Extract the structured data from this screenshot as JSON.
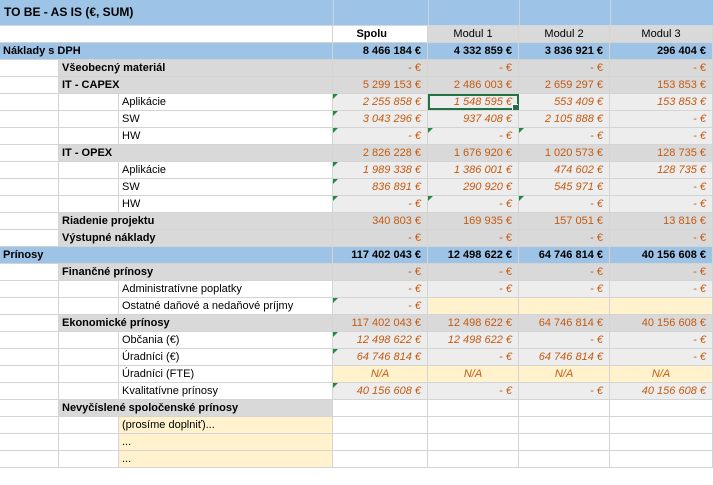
{
  "title": "TO BE - AS IS (€, SUM)",
  "headers": [
    "Spolu",
    "Modul 1",
    "Modul 2",
    "Modul 3"
  ],
  "rows": [
    {
      "label": "Náklady s DPH",
      "values": [
        "8 466 184 €",
        "4 332 859 €",
        "3 836 921 €",
        "296 404 €"
      ]
    },
    {
      "label": "Všeobecný materiál",
      "values": [
        "- €",
        "- €",
        "- €",
        "- €"
      ]
    },
    {
      "label": "IT - CAPEX",
      "values": [
        "5 299 153 €",
        "2 486 003 €",
        "2 659 297 €",
        "153 853 €"
      ]
    },
    {
      "label": "Aplikácie",
      "values": [
        "2 255 858 €",
        "1 548 595 €",
        "553 409 €",
        "153 853 €"
      ]
    },
    {
      "label": "SW",
      "values": [
        "3 043 296 €",
        "937 408 €",
        "2 105 888 €",
        "- €"
      ]
    },
    {
      "label": "HW",
      "values": [
        "- €",
        "- €",
        "- €",
        "- €"
      ]
    },
    {
      "label": "IT - OPEX",
      "values": [
        "2 826 228 €",
        "1 676 920 €",
        "1 020 573 €",
        "128 735 €"
      ]
    },
    {
      "label": "Aplikácie",
      "values": [
        "1 989 338 €",
        "1 386 001 €",
        "474 602 €",
        "128 735 €"
      ]
    },
    {
      "label": "SW",
      "values": [
        "836 891 €",
        "290 920 €",
        "545 971 €",
        "- €"
      ]
    },
    {
      "label": "HW",
      "values": [
        "- €",
        "- €",
        "- €",
        "- €"
      ]
    },
    {
      "label": "Riadenie projektu",
      "values": [
        "340 803 €",
        "169 935 €",
        "157 051 €",
        "13 816 €"
      ]
    },
    {
      "label": "Výstupné náklady",
      "values": [
        "- €",
        "- €",
        "- €",
        "- €"
      ]
    },
    {
      "label": "Prínosy",
      "values": [
        "117 402 043 €",
        "12 498 622 €",
        "64 746 814 €",
        "40 156 608 €"
      ]
    },
    {
      "label": "Finančné prínosy",
      "values": [
        "- €",
        "- €",
        "- €",
        "- €"
      ]
    },
    {
      "label": "Administratívne poplatky",
      "values": [
        "- €",
        "- €",
        "- €",
        "- €"
      ]
    },
    {
      "label": "Ostatné daňové a nedaňové príjmy",
      "values": [
        "- €",
        "",
        "",
        ""
      ]
    },
    {
      "label": "Ekonomické prínosy",
      "values": [
        "117 402 043 €",
        "12 498 622 €",
        "64 746 814 €",
        "40 156 608 €"
      ]
    },
    {
      "label": "Občania (€)",
      "values": [
        "12 498 622 €",
        "12 498 622 €",
        "- €",
        "- €"
      ]
    },
    {
      "label": "Úradníci (€)",
      "values": [
        "64 746 814 €",
        "- €",
        "64 746 814 €",
        "- €"
      ]
    },
    {
      "label": "Úradníci (FTE)",
      "values": [
        "N/A",
        "N/A",
        "N/A",
        "N/A"
      ]
    },
    {
      "label": "Kvalitatívne prínosy",
      "values": [
        "40 156 608 €",
        "- €",
        "- €",
        "40 156 608 €"
      ]
    },
    {
      "label": "Nevyčíslené spoločenské prínosy",
      "values": [
        "",
        "",
        "",
        ""
      ]
    },
    {
      "label": "(prosíme doplniť)...",
      "values": [
        "",
        "",
        "",
        ""
      ]
    },
    {
      "label": "...",
      "values": [
        "",
        "",
        "",
        ""
      ]
    },
    {
      "label": "...",
      "values": [
        "",
        "",
        "",
        ""
      ]
    }
  ]
}
